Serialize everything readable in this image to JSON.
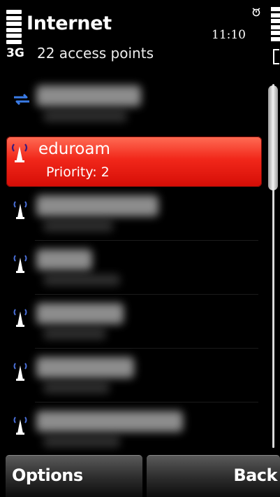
{
  "header": {
    "app_title": "Internet",
    "time": "11:10",
    "network_type": "3G",
    "subtitle": "22 access points"
  },
  "list": {
    "selected_item": {
      "name": "eduroam",
      "priority": "Priority: 2"
    }
  },
  "softkeys": {
    "left_label": "Options",
    "right_label": "Back"
  },
  "colors": {
    "selection": "#e8231b",
    "background": "#000000",
    "transfer_icon": "#3a7be6"
  },
  "icons": [
    "signal-strength-icon",
    "alarm-icon",
    "battery-icon",
    "data-transfer-icon",
    "antenna-icon"
  ]
}
